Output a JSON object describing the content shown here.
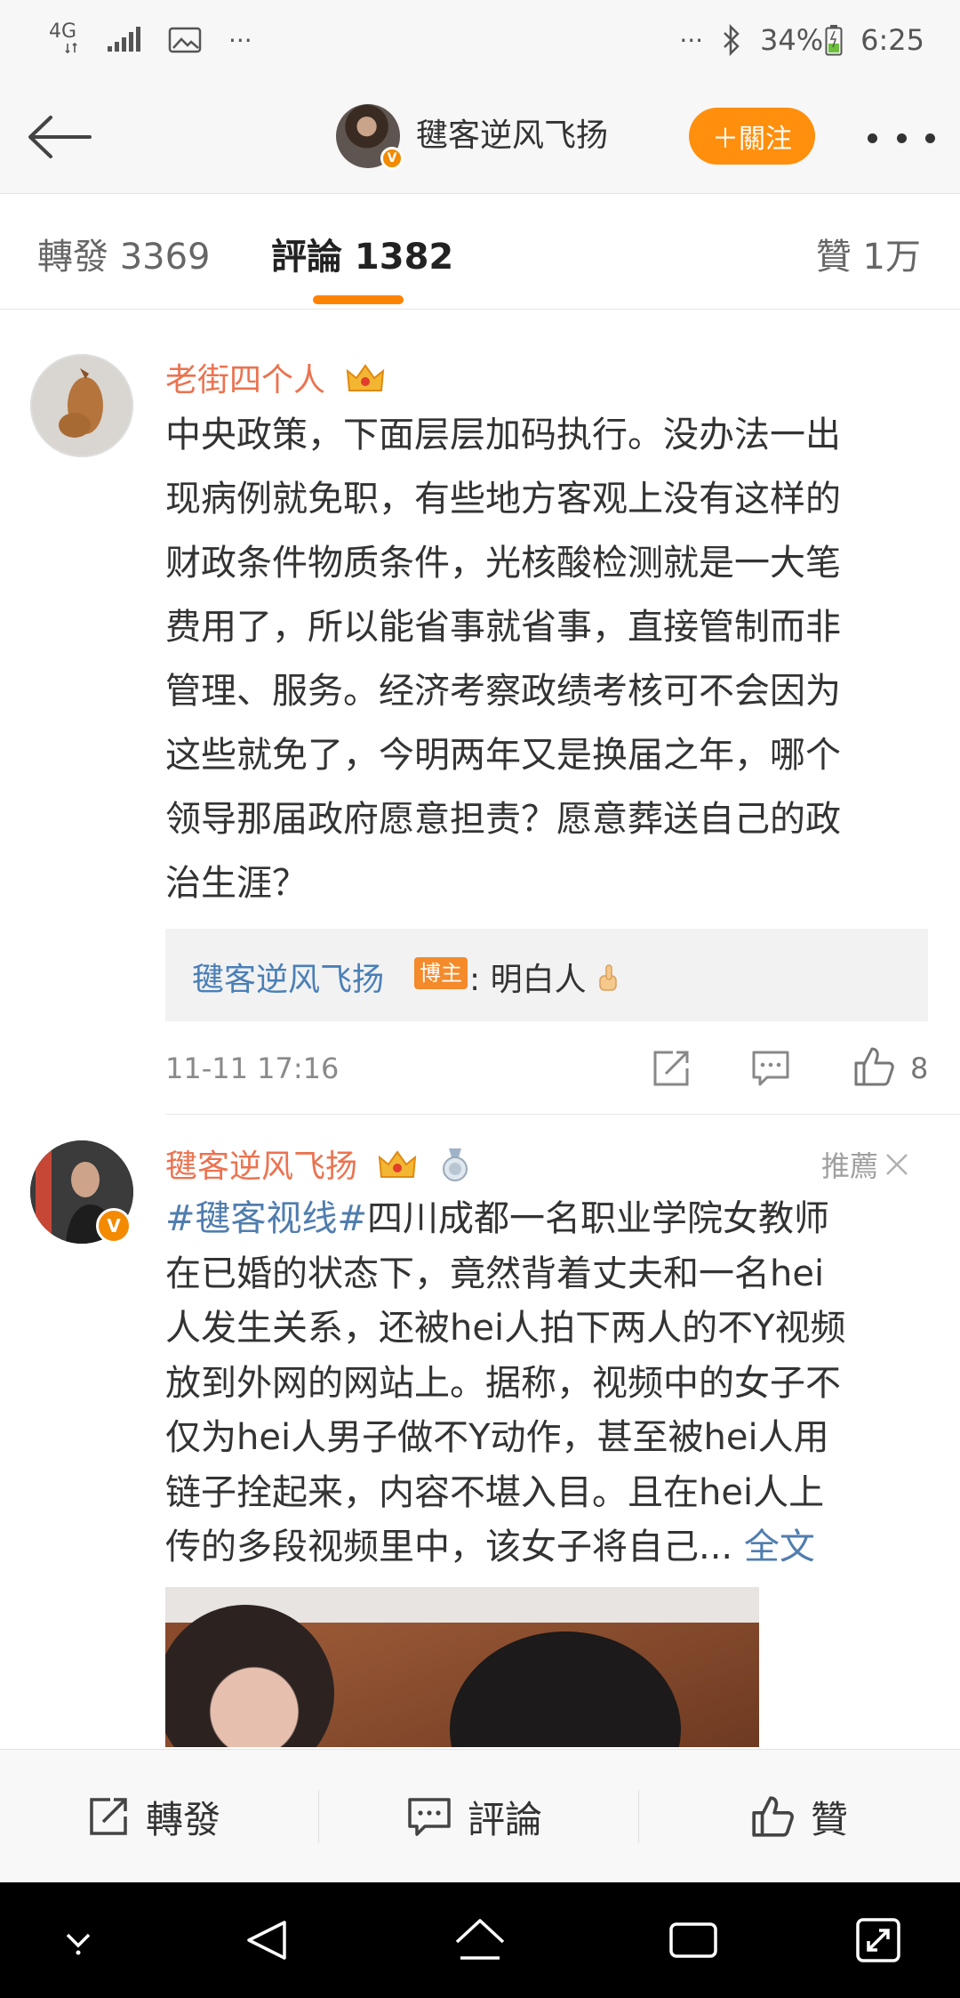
{
  "status_bar": {
    "network_label": "4G",
    "more_left": "···",
    "more_right": "···",
    "battery": "34%",
    "time": "6:25"
  },
  "header": {
    "title": "毽客逆风飞扬",
    "follow_label": "＋關注",
    "verified_mark": "V"
  },
  "tabs": {
    "forward": "轉發 3369",
    "comments": "評論 1382",
    "likes": "贊 1万",
    "active": "comments"
  },
  "comment": {
    "username": "老街四个人",
    "text_lines": [
      "中央政策，下面层层加码执行。没办法一出",
      "现病例就免职，有些地方客观上没有这样的",
      "财政条件物质条件，光核酸检测就是一大笔",
      "费用了，所以能省事就省事，直接管制而非",
      "管理、服务。经济考察政绩考核可不会因为",
      "这些就免了，今明两年又是换届之年，哪个",
      "领导那届政府愿意担责？愿意葬送自己的政",
      "治生涯？"
    ],
    "reply": {
      "name": "毽客逆风飞扬",
      "tag": "博主",
      "text": ": 明白人"
    },
    "time": "11-11 17:16",
    "like_count": "8"
  },
  "recommended_post": {
    "username": "毽客逆风飞扬",
    "label": "推薦",
    "topic": "#毽客视线#",
    "lines": [
      "四川成都一名职业学院女教师",
      "在已婚的状态下，竟然背着丈夫和一名hei",
      "人发生关系，还被hei人拍下两人的不Y视频",
      "放到外网的网站上。据称，视频中的女子不",
      "仅为hei人男子做不Y动作，甚至被hei人用",
      "链子拴起来，内容不堪入目。且在hei人上",
      "传的多段视频里中，该女子将自己..."
    ],
    "fulltext": "全文"
  },
  "action_bar": {
    "forward": "轉發",
    "comment": "評論",
    "like": "贊"
  },
  "colors": {
    "accent_orange": "#ff8200",
    "username_orange": "#eb7350",
    "link_blue": "#507daf"
  }
}
